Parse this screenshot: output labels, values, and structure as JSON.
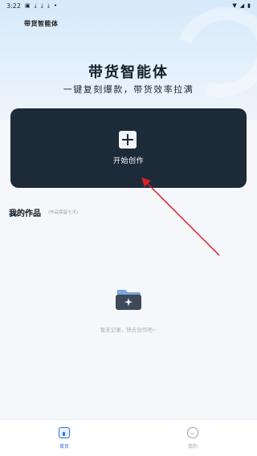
{
  "status_bar": {
    "time": "3:22",
    "icons": [
      "photo-icon",
      "download-icon",
      "download-icon",
      "download-icon",
      "dot-icon"
    ],
    "right_icons": [
      "wifi-icon",
      "signal-icon",
      "battery-icon"
    ]
  },
  "header": {
    "app_logo": "带货智能体",
    "title": "带货智能体",
    "subtitle": "一键复刻爆款，带货效率拉满"
  },
  "create_card": {
    "label": "开始创作",
    "icon": "plus-icon",
    "background": "#1d2a38"
  },
  "works": {
    "title": "我的作品",
    "note": "(作品保留七天)",
    "empty_text": "暂无记录，快去创作吧~",
    "empty_icon": "folder-sparkle-icon"
  },
  "tab_bar": {
    "tabs": [
      {
        "label": "首页",
        "icon": "home-icon",
        "active": true
      },
      {
        "label": "我的",
        "icon": "profile-icon",
        "active": false
      }
    ],
    "active_color": "#2f6fe0"
  },
  "annotation": {
    "arrow_color": "#d9222a"
  }
}
